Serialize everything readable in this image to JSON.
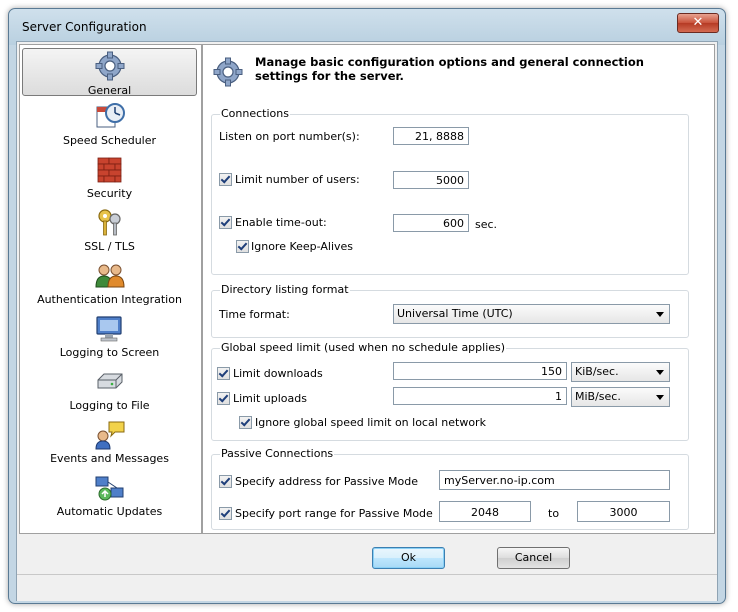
{
  "window": {
    "title": "Server Configuration",
    "close_glyph": "✕"
  },
  "sidebar": {
    "items": [
      {
        "label": "General",
        "icon": "gear-icon",
        "active": true
      },
      {
        "label": "Speed Scheduler",
        "icon": "clock-calendar-icon"
      },
      {
        "label": "Security",
        "icon": "brick-wall-icon"
      },
      {
        "label": "SSL / TLS",
        "icon": "keys-icon"
      },
      {
        "label": "Authentication Integration",
        "icon": "users-icon"
      },
      {
        "label": "Logging to Screen",
        "icon": "monitor-icon"
      },
      {
        "label": "Logging to File",
        "icon": "disk-drive-icon"
      },
      {
        "label": "Events and Messages",
        "icon": "messages-icon"
      },
      {
        "label": "Automatic Updates",
        "icon": "network-update-icon"
      }
    ]
  },
  "header": {
    "text": "Manage basic configuration options and general connection settings for the server."
  },
  "connections": {
    "title": "Connections",
    "port_label": "Listen on port number(s):",
    "port_value": "21, 8888",
    "limit_users_label": "Limit number of users:",
    "limit_users_value": "5000",
    "timeout_label": "Enable time-out:",
    "timeout_value": "600",
    "timeout_unit": "sec.",
    "keepalive_label": "Ignore Keep-Alives"
  },
  "directory": {
    "title": "Directory listing format",
    "time_format_label": "Time format:",
    "time_format_value": "Universal Time (UTC)"
  },
  "speed": {
    "title": "Global speed limit (used when no schedule applies)",
    "downloads_label": "Limit downloads",
    "downloads_value": "150",
    "downloads_unit": "KiB/sec.",
    "uploads_label": "Limit uploads",
    "uploads_value": "1",
    "uploads_unit": "MiB/sec.",
    "local_label": "Ignore global speed limit on local network"
  },
  "passive": {
    "title": "Passive Connections",
    "address_label": "Specify address for Passive Mode",
    "address_value": "myServer.no-ip.com",
    "range_label": "Specify port range for Passive Mode",
    "range_from": "2048",
    "range_to_label": "to",
    "range_to": "3000"
  },
  "buttons": {
    "ok": "Ok",
    "cancel": "Cancel"
  },
  "colors": {
    "accent": "#3c7fb1",
    "title_bar": "#b9d0e0",
    "close": "#c8513a"
  }
}
